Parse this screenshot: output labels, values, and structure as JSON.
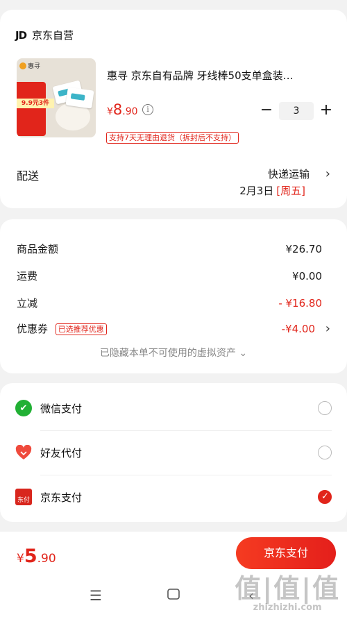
{
  "shop": {
    "logo": "JD",
    "name": "京东自营"
  },
  "product": {
    "title": "惠寻  京东自有品牌  牙线棒50支单盒装…",
    "image_brand": "惠寻",
    "image_promo": "9.9元3件",
    "price_yen": "¥",
    "price_int": "8",
    "price_dec": ".90",
    "quantity": "3",
    "minus": "−",
    "plus": "+",
    "return_policy": "支持7天无理由退货（拆封后不支持）"
  },
  "delivery": {
    "label": "配送",
    "method": "快递运输",
    "date": "2月3日",
    "weekday": "[周五]"
  },
  "amounts": {
    "goods": {
      "label": "商品金额",
      "value": "¥26.70"
    },
    "shipping": {
      "label": "运费",
      "value": "¥0.00"
    },
    "discount": {
      "label": "立减",
      "value": "- ¥16.80"
    },
    "coupon": {
      "label": "优惠券",
      "tag": "已选推荐优惠",
      "value": "-¥4.00"
    },
    "hidden_assets": "已隐藏本单不可使用的虚拟资产 ⌄"
  },
  "payment": {
    "methods": [
      {
        "label": "微信支付",
        "selected": false
      },
      {
        "label": "好友代付",
        "selected": false
      },
      {
        "label": "京东支付",
        "selected": true
      }
    ]
  },
  "footer": {
    "total_yen": "¥",
    "total_int": "5",
    "total_dec": ".90",
    "pay_button": "京东支付"
  },
  "watermark": {
    "big": "值|值|值",
    "small": "zhizhizhi.com"
  }
}
